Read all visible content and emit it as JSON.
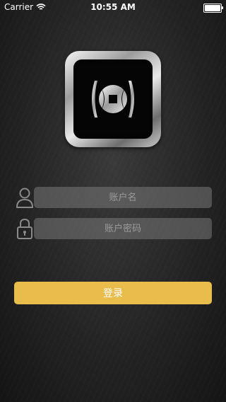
{
  "status_bar": {
    "carrier": "Carrier",
    "time": "10:55 AM",
    "battery_level": 1.0
  },
  "login": {
    "username_placeholder": "账户名",
    "password_placeholder": "账户密码",
    "submit_label": "登录"
  },
  "icons": {
    "signal": "wifi-icon",
    "battery": "battery-icon",
    "logo": "app-logo-icon",
    "user": "user-icon",
    "lock": "lock-icon"
  },
  "colors": {
    "accent": "#e8bd4b",
    "field_bg": "#6e6e6e"
  }
}
